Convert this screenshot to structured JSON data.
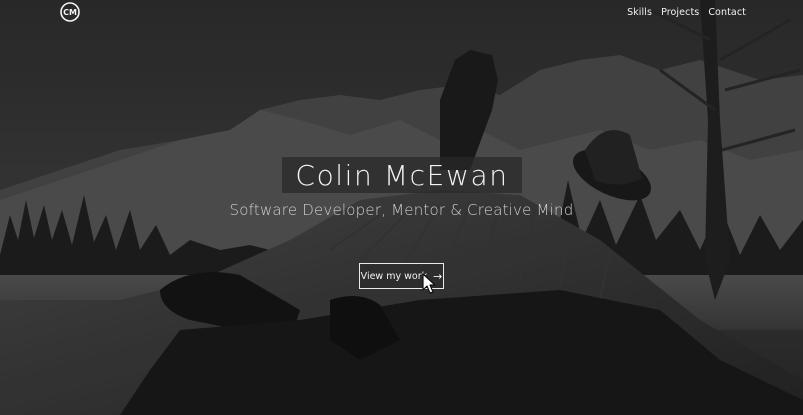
{
  "header": {
    "logo_text": "CM",
    "nav": [
      {
        "label": "Skills"
      },
      {
        "label": "Projects"
      },
      {
        "label": "Contact"
      }
    ]
  },
  "hero": {
    "title": "Colin McEwan",
    "subtitle": "Software Developer, Mentor & Creative Mind",
    "cta_label": "View my work",
    "cta_icon": "arrow-right-icon"
  },
  "colors": {
    "text": "#ffffff",
    "title_box": "#282828",
    "subtitle": "#cfcfcf"
  }
}
